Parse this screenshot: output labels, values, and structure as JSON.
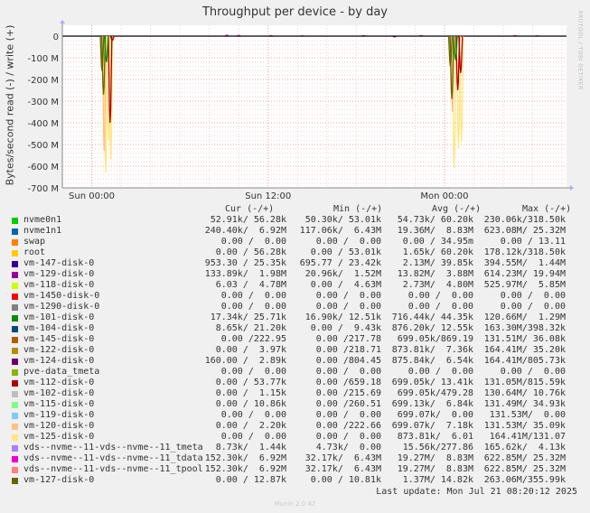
{
  "chart_data": {
    "type": "line",
    "title": "Throughput per device - by day",
    "ylabel": "Bytes/second read (-) / write (+)",
    "y_ticks": [
      "0",
      "-100 M",
      "-200 M",
      "-300 M",
      "-400 M",
      "-500 M",
      "-600 M",
      "-700 M"
    ],
    "y_tick_values": [
      0,
      -100,
      -200,
      -300,
      -400,
      -500,
      -600,
      -700
    ],
    "ylim": [
      -700,
      0
    ],
    "y_unit": "MB/s",
    "x_ticks": [
      "Sun 00:00",
      "Sun 12:00",
      "Mon 00:00"
    ],
    "x_tick_hours": [
      0,
      12,
      24
    ],
    "xlim_hours": [
      -2,
      32.3
    ],
    "grid": true,
    "series": [
      {
        "name": "vm-125-disk-0",
        "read_spikes": [
          {
            "hour": 0.95,
            "value": -630
          },
          {
            "hour": 1.15,
            "value": -480
          },
          {
            "hour": 1.3,
            "value": -570
          },
          {
            "hour": 24.65,
            "value": -610
          },
          {
            "hour": 24.95,
            "value": -520
          },
          {
            "hour": 25.15,
            "value": -490
          }
        ]
      },
      {
        "name": "vm-112-disk-0",
        "read_spikes": [
          {
            "hour": 1.25,
            "value": -400
          },
          {
            "hour": 1.4,
            "value": -20
          },
          {
            "hour": 24.9,
            "value": -250
          },
          {
            "hour": 25.1,
            "value": -170
          }
        ]
      },
      {
        "name": "vm-120-disk-0",
        "read_spikes": [
          {
            "hour": 0.85,
            "value": -530
          },
          {
            "hour": 24.55,
            "value": -350
          }
        ]
      },
      {
        "name": "vm-127-disk-0",
        "read_spikes": [
          {
            "hour": 0.7,
            "value": -160
          },
          {
            "hour": 0.8,
            "value": -270
          },
          {
            "hour": 24.4,
            "value": -140
          },
          {
            "hour": 24.5,
            "value": -290
          }
        ]
      },
      {
        "name": "vm-101-disk-0",
        "read_spikes": [
          {
            "hour": 1.0,
            "value": -120
          },
          {
            "hour": 24.75,
            "value": -110
          }
        ]
      }
    ],
    "write_activity": [
      {
        "hour": 9.2,
        "value": 6
      },
      {
        "hour": 10.0,
        "value": 4
      },
      {
        "hour": 12.2,
        "value": 3
      },
      {
        "hour": 14.3,
        "value": 2
      },
      {
        "hour": 18.5,
        "value": 3
      },
      {
        "hour": 20.6,
        "value": -5
      },
      {
        "hour": 22.4,
        "value": 3
      },
      {
        "hour": 28.8,
        "value": 3
      },
      {
        "hour": 30.3,
        "value": 2
      }
    ]
  },
  "side_label": "RRDTOOL / TOBI OETIKER",
  "legend": {
    "headers": {
      "cur": "Cur (-/+)",
      "min": "Min (-/+)",
      "avg": "Avg (-/+)",
      "max": "Max (-/+)"
    },
    "rows": [
      {
        "name": "nvme0n1",
        "color": "#00cc00",
        "cur": "52.91k/ 56.28k",
        "min": "50.30k/ 53.01k",
        "avg": "54.73k/ 60.20k",
        "max": "230.06k/318.50k"
      },
      {
        "name": "nvme1n1",
        "color": "#0066b3",
        "cur": "240.40k/  6.92M",
        "min": "117.06k/  6.43M",
        "avg": "19.36M/  8.83M",
        "max": "623.08M/ 25.32M"
      },
      {
        "name": "swap",
        "color": "#ff8000",
        "cur": "0.00 /  0.00",
        "min": "0.00 /  0.00",
        "avg": "0.00 / 34.95m",
        "max": "0.00 / 13.11"
      },
      {
        "name": "root",
        "color": "#ffcc00",
        "cur": "0.00 / 56.28k",
        "min": "0.00 / 53.01k",
        "avg": "1.65k/ 60.20k",
        "max": "178.12k/318.50k"
      },
      {
        "name": "vm-147-disk-0",
        "color": "#330099",
        "cur": "953.30 / 25.35k",
        "min": "695.77 / 23.42k",
        "avg": "2.13M/ 39.85k",
        "max": "394.55M/  1.44M"
      },
      {
        "name": "vm-129-disk-0",
        "color": "#990099",
        "cur": "133.89k/  1.98M",
        "min": "20.96k/  1.52M",
        "avg": "13.82M/  3.88M",
        "max": "614.23M/ 19.94M"
      },
      {
        "name": "vm-118-disk-0",
        "color": "#ccff00",
        "cur": "6.03 /  4.78M",
        "min": "0.00 /  4.63M",
        "avg": "2.73M/  4.80M",
        "max": "525.97M/  5.85M"
      },
      {
        "name": "vm-1450-disk-0",
        "color": "#ff0000",
        "cur": "0.00 /  0.00",
        "min": "0.00 /  0.00",
        "avg": "0.00 /  0.00",
        "max": "0.00 /  0.00"
      },
      {
        "name": "vm-1290-disk-0",
        "color": "#808080",
        "cur": "0.00 /  0.00",
        "min": "0.00 /  0.00",
        "avg": "0.00 /  0.00",
        "max": "0.00 /  0.00"
      },
      {
        "name": "vm-101-disk-0",
        "color": "#008f00",
        "cur": "17.34k/ 25.71k",
        "min": "16.90k/ 12.51k",
        "avg": "716.44k/ 44.35k",
        "max": "120.66M/  1.29M"
      },
      {
        "name": "vm-104-disk-0",
        "color": "#00487d",
        "cur": "8.65k/ 21.20k",
        "min": "0.00 /  9.43k",
        "avg": "876.20k/ 12.55k",
        "max": "163.30M/398.32k"
      },
      {
        "name": "vm-145-disk-0",
        "color": "#b35a00",
        "cur": "0.00 /222.95",
        "min": "0.00 /217.78",
        "avg": "699.05k/869.19",
        "max": "131.51M/ 36.08k"
      },
      {
        "name": "vm-122-disk-0",
        "color": "#b38f00",
        "cur": "0.00 /  3.97k",
        "min": "0.00 /218.71",
        "avg": "873.81k/  7.36k",
        "max": "164.41M/ 35.20k"
      },
      {
        "name": "vm-124-disk-0",
        "color": "#6b006b",
        "cur": "160.00 /  2.89k",
        "min": "0.00 /804.45",
        "avg": "875.84k/  6.54k",
        "max": "164.41M/805.73k"
      },
      {
        "name": "pve-data_tmeta",
        "color": "#8fb300",
        "cur": "0.00 /  0.00",
        "min": "0.00 /  0.00",
        "avg": "0.00 /  0.00",
        "max": "0.00 /  0.00"
      },
      {
        "name": "vm-112-disk-0",
        "color": "#b30000",
        "cur": "0.00 / 53.77k",
        "min": "0.00 /659.18",
        "avg": "699.05k/ 13.41k",
        "max": "131.05M/815.59k"
      },
      {
        "name": "vm-102-disk-0",
        "color": "#bebebe",
        "cur": "0.00 /  1.15k",
        "min": "0.00 /215.69",
        "avg": "699.05k/479.28",
        "max": "130.64M/ 10.76k"
      },
      {
        "name": "vm-115-disk-0",
        "color": "#80ff80",
        "cur": "0.00 / 10.86k",
        "min": "0.00 /260.51",
        "avg": "699.13k/  6.84k",
        "max": "131.49M/ 34.93k"
      },
      {
        "name": "vm-119-disk-0",
        "color": "#80c9ff",
        "cur": "0.00 /  0.00",
        "min": "0.00 /  0.00",
        "avg": "699.07k/  0.00",
        "max": "131.53M/  0.00"
      },
      {
        "name": "vm-120-disk-0",
        "color": "#ffc080",
        "cur": "0.00 /  2.20k",
        "min": "0.00 /222.66",
        "avg": "699.07k/  7.18k",
        "max": "131.53M/ 35.09k"
      },
      {
        "name": "vm-125-disk-0",
        "color": "#ffe680",
        "cur": "0.00 /  0.00",
        "min": "0.00 /  0.00",
        "avg": "873.81k/  6.01",
        "max": "164.41M/131.07"
      },
      {
        "name": "vds--nvme--11-vds--nvme--11_tmeta",
        "color": "#aa80ff",
        "cur": "8.73k/  1.44k",
        "min": "4.73k/  0.00",
        "avg": "15.56k/277.86",
        "max": "165.62k/  4.13k"
      },
      {
        "name": "vds--nvme--11-vds--nvme--11_tdata",
        "color": "#ee00cc",
        "cur": "152.30k/  6.92M",
        "min": "32.17k/  6.43M",
        "avg": "19.27M/  8.83M",
        "max": "622.85M/ 25.32M"
      },
      {
        "name": "vds--nvme--11-vds--nvme--11_tpool",
        "color": "#ff8080",
        "cur": "152.30k/  6.92M",
        "min": "32.17k/  6.43M",
        "avg": "19.27M/  8.83M",
        "max": "622.85M/ 25.32M"
      },
      {
        "name": "vm-127-disk-0",
        "color": "#666600",
        "cur": "0.00 / 12.87k",
        "min": "0.00 / 10.81k",
        "avg": "1.37M/ 14.82k",
        "max": "263.06M/355.99k"
      }
    ]
  },
  "last_update": "Last update: Mon Jul 21 08:20:12 2025",
  "footer": "Munin 2.0.42"
}
